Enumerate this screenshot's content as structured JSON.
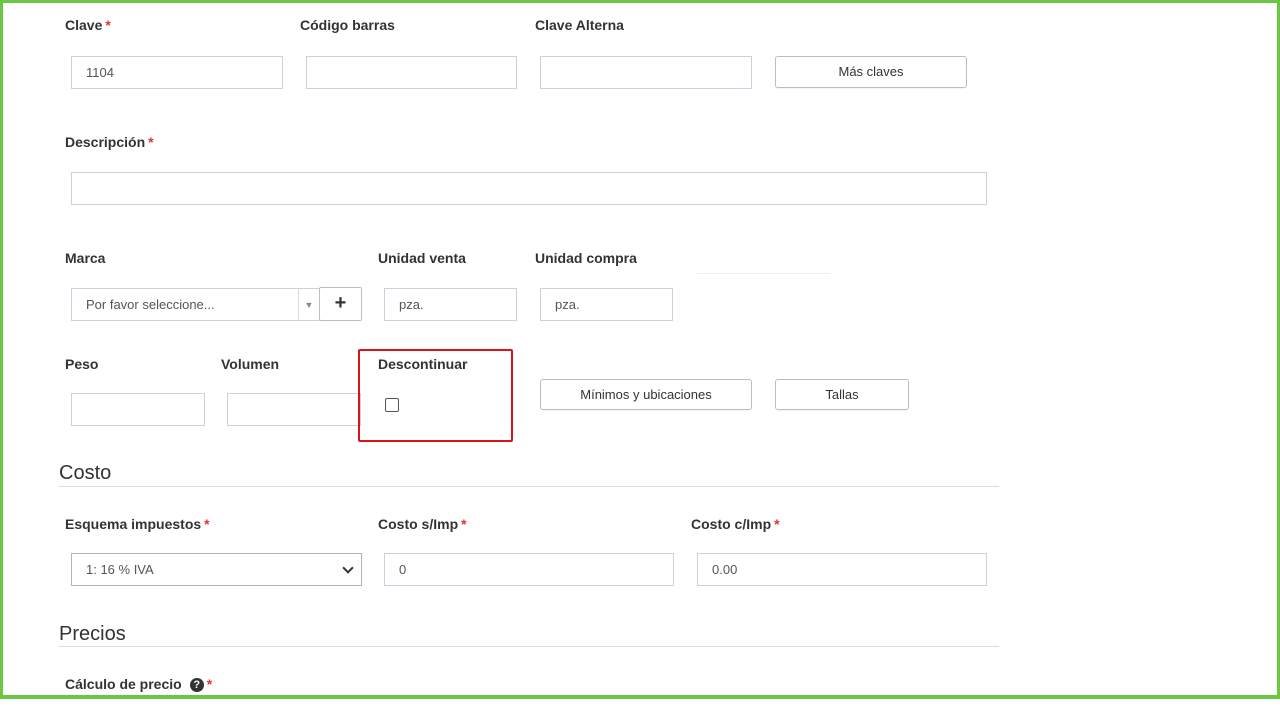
{
  "fields": {
    "clave": {
      "label": "Clave",
      "required": "*",
      "value": "1104"
    },
    "codigo_barras": {
      "label": "Código barras",
      "value": ""
    },
    "clave_alterna": {
      "label": "Clave Alterna",
      "value": ""
    },
    "mas_claves_button": "Más claves",
    "descripcion": {
      "label": "Descripción",
      "required": "*",
      "value": ""
    },
    "marca": {
      "label": "Marca",
      "placeholder": "Por favor seleccione...",
      "add_button": "+"
    },
    "unidad_venta": {
      "label": "Unidad venta",
      "value": "pza."
    },
    "unidad_compra": {
      "label": "Unidad compra",
      "value": "pza."
    },
    "peso": {
      "label": "Peso",
      "value": ""
    },
    "volumen": {
      "label": "Volumen",
      "value": ""
    },
    "descontinuar": {
      "label": "Descontinuar",
      "checked": false
    },
    "minimos_button": "Mínimos y ubicaciones",
    "tallas_button": "Tallas"
  },
  "costo": {
    "title": "Costo",
    "esquema_impuestos": {
      "label": "Esquema impuestos",
      "required": "*",
      "value": "1: 16 % IVA"
    },
    "costo_sin_imp": {
      "label": "Costo s/Imp",
      "required": "*",
      "value": "0"
    },
    "costo_con_imp": {
      "label": "Costo c/Imp",
      "required": "*",
      "value": "0.00"
    }
  },
  "precios": {
    "title": "Precios",
    "calculo_precio": {
      "label": "Cálculo de precio",
      "help_icon": "?",
      "required": "*"
    }
  },
  "colors": {
    "frame_border": "#6cc644",
    "highlight_border": "#d9141b",
    "required_marker": "#e0342b"
  }
}
